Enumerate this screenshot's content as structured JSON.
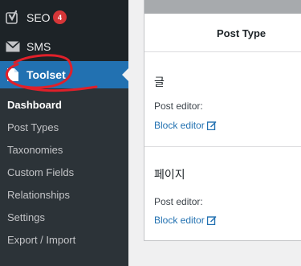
{
  "sidebar": {
    "menu": [
      {
        "id": "seo",
        "label": "SEO",
        "icon": "yoast-seo-icon",
        "badge": "4"
      },
      {
        "id": "sms",
        "label": "SMS",
        "icon": "envelope-icon"
      },
      {
        "id": "toolset",
        "label": "Toolset",
        "icon": "toolset-icon",
        "active": true
      }
    ],
    "submenu": [
      {
        "label": "Dashboard",
        "current": true
      },
      {
        "label": "Post Types"
      },
      {
        "label": "Taxonomies"
      },
      {
        "label": "Custom Fields"
      },
      {
        "label": "Relationships"
      },
      {
        "label": "Settings"
      },
      {
        "label": "Export / Import"
      }
    ]
  },
  "main": {
    "column_header": "Post Type",
    "rows": [
      {
        "title": "글",
        "editor_label": "Post editor:",
        "editor_link": "Block editor"
      },
      {
        "title": "페이지",
        "editor_label": "Post editor:",
        "editor_link": "Block editor"
      }
    ]
  },
  "colors": {
    "sidebar_bg": "#1d2327",
    "submenu_bg": "#2c3338",
    "active_bg": "#2271b1",
    "badge_bg": "#d63638",
    "link": "#2271b1",
    "annotation": "#e0202a"
  }
}
